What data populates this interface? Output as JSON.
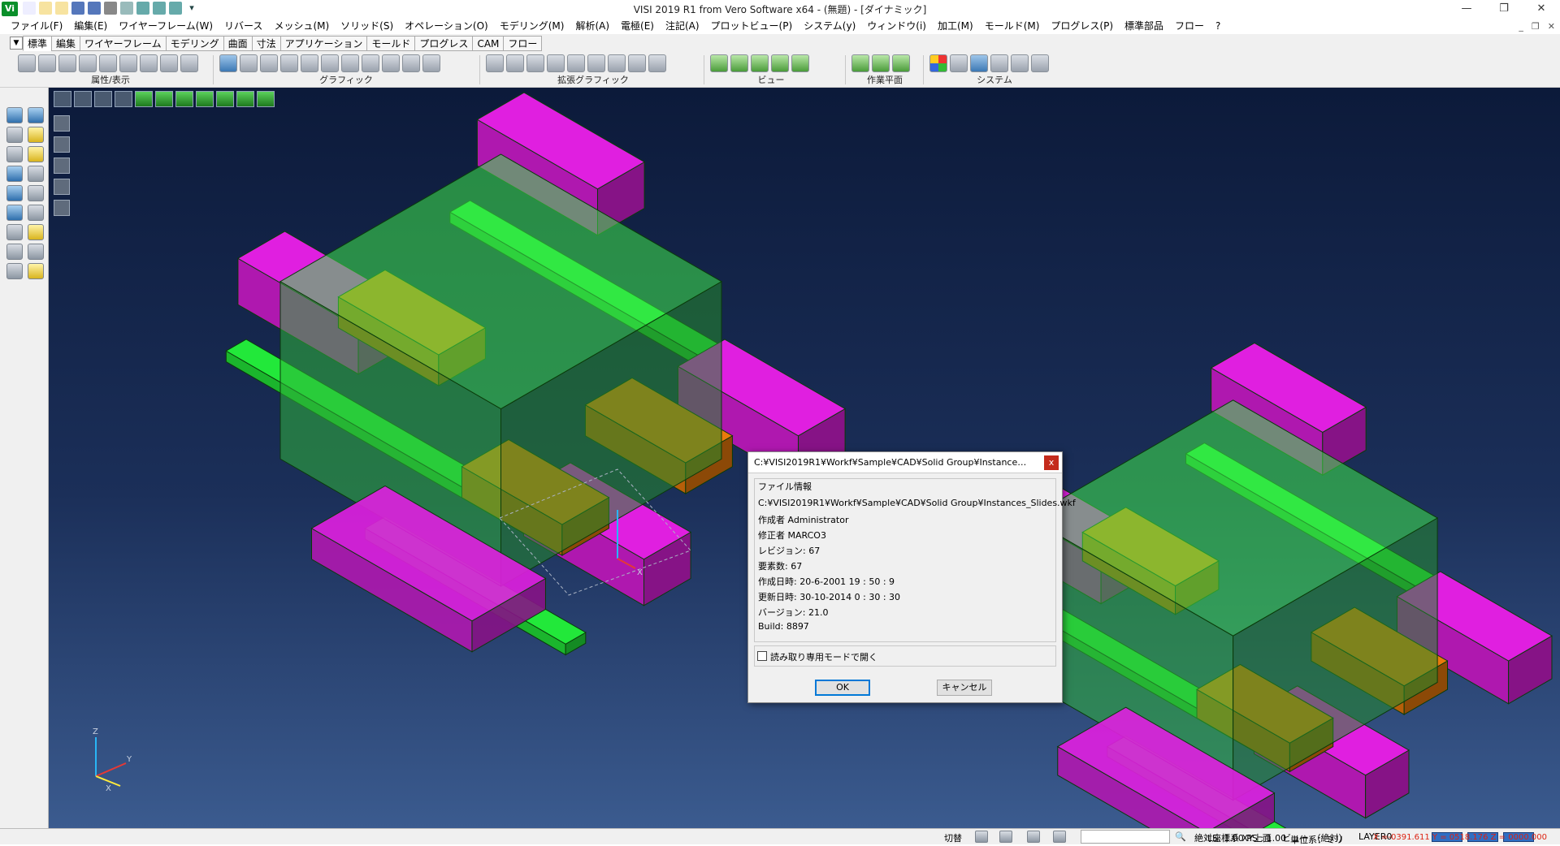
{
  "app": {
    "logo": "Vi",
    "title": "VISI 2019 R1 from Vero Software x64 - (無題) - [ダイナミック]"
  },
  "qat": [
    {
      "icon": "new-file-icon"
    },
    {
      "icon": "open-folder-icon"
    },
    {
      "icon": "open-file-icon"
    },
    {
      "icon": "save-icon"
    },
    {
      "icon": "save-as-icon"
    },
    {
      "icon": "print-icon"
    },
    {
      "icon": "zoom-icon"
    },
    {
      "icon": "undo-icon"
    },
    {
      "icon": "redo-icon"
    },
    {
      "icon": "repeat-icon"
    },
    {
      "icon": "customize-dropdown-icon"
    }
  ],
  "window_controls": {
    "minimize": "—",
    "restore": "❐",
    "close": "✕"
  },
  "menu": [
    "ファイル(F)",
    "編集(E)",
    "ワイヤーフレーム(W)",
    "リバース",
    "メッシュ(M)",
    "ソリッド(S)",
    "オペレーション(O)",
    "モデリング(M)",
    "解析(A)",
    "電極(E)",
    "注記(A)",
    "プロットビュー(P)",
    "システム(y)",
    "ウィンドウ(i)",
    "加工(M)",
    "モールド(M)",
    "プログレス(P)",
    "標準部品",
    "フロー",
    "?"
  ],
  "mdi_controls": {
    "minimize": "_",
    "restore": "❐",
    "close": "✕"
  },
  "ribbon_tabs": [
    {
      "label": "標準",
      "active": true
    },
    {
      "label": "編集"
    },
    {
      "label": "ワイヤーフレーム"
    },
    {
      "label": "モデリング"
    },
    {
      "label": "曲面"
    },
    {
      "label": "寸法"
    },
    {
      "label": "アプリケーション"
    },
    {
      "label": "モールド"
    },
    {
      "label": "プログレス"
    },
    {
      "label": "CAM"
    },
    {
      "label": "フロー"
    }
  ],
  "toolbar_groups": [
    {
      "label": "属性/表示",
      "icons": 9
    },
    {
      "label": "グラフィック",
      "icons": 11
    },
    {
      "label": "拡張グラフィック",
      "icons": 9
    },
    {
      "label": "ビュー",
      "icons": 5
    },
    {
      "label": "作業平面",
      "icons": 3
    },
    {
      "label": "システム",
      "icons": 6
    }
  ],
  "status": {
    "mode": "切替",
    "coord_system": "絶対座標系 XY上面",
    "view": "ビュー （絶対）",
    "layer": "LAYER0",
    "ls_ps": "LS: 1.00 PS : 1.00",
    "units": "単位系：ミリ",
    "coords": "X =-0391.611 Y = 0518.176 Z = 0000.000"
  },
  "dialog": {
    "title": "C:¥VISI2019R1¥Workf¥Sample¥CAD¥Solid Group¥Instances_Slides....",
    "close": "x",
    "group_label": "ファイル情報",
    "path": "C:¥VISI2019R1¥Workf¥Sample¥CAD¥Solid Group¥Instances_Slides.wkf",
    "author": "作成者 Administrator",
    "modifier": "修正者 MARCO3",
    "revision": "レビジョン: 67",
    "elements": "要素数: 67",
    "created": "作成日時: 20-6-2001 19 : 50 : 9",
    "updated": "更新日時: 30-10-2014 0 : 30 : 30",
    "version": "バージョン: 21.0",
    "build": "Build: 8897",
    "readonly_label": "読み取り専用モードで開く",
    "readonly_checked": false,
    "ok": "OK",
    "cancel": "キャンセル"
  },
  "viewport": {
    "triad_labels": {
      "x": "X",
      "y": "Y",
      "z": "Z"
    },
    "colors": {
      "slide_plate": "#22e83a",
      "mold_block": "#3ee84a",
      "slider": "#e01fe0",
      "wedge": "#ea7a0c",
      "bg_top": "#0c1a3a",
      "bg_bottom": "#3b5b8f"
    }
  }
}
